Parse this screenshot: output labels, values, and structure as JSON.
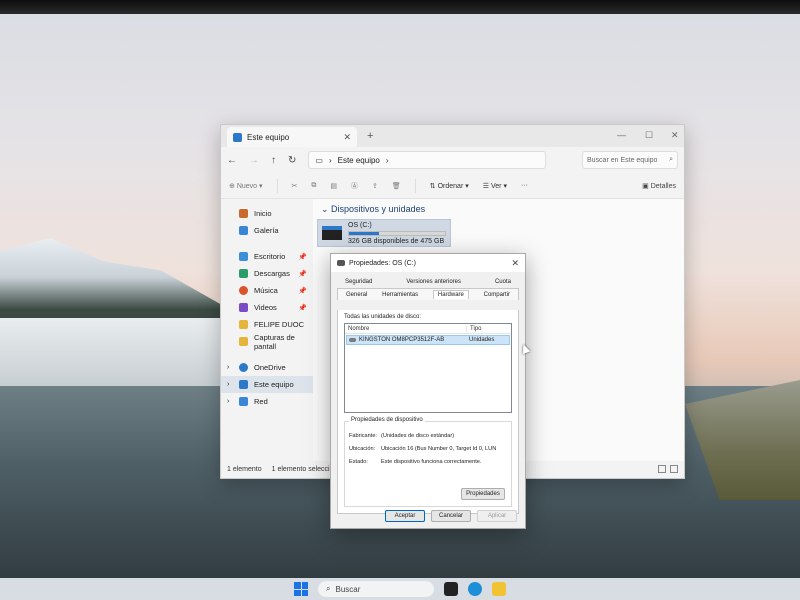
{
  "explorer": {
    "tab_title": "Este equipo",
    "tab_close": "✕",
    "new_tab": "+",
    "window_controls": [
      "—",
      "☐",
      "✕"
    ],
    "address": "Este equipo",
    "search_placeholder": "Buscar en Este equipo",
    "toolbar": {
      "new_label": "Nuevo",
      "sort_label": "Ordenar",
      "view_label": "Ver",
      "more_label": "···",
      "details_label": "Detalles"
    },
    "nav": {
      "items": [
        {
          "label": "Inicio"
        },
        {
          "label": "Galería"
        },
        {
          "label": "Escritorio"
        },
        {
          "label": "Descargas"
        },
        {
          "label": "Música"
        },
        {
          "label": "Videos"
        },
        {
          "label": "FELIPE DUOC"
        },
        {
          "label": "Capturas de pantall"
        },
        {
          "label": "OneDrive"
        },
        {
          "label": "Este equipo"
        },
        {
          "label": "Red"
        }
      ]
    },
    "section_title": "Dispositivos y unidades",
    "drive": {
      "name": "OS (C:)",
      "free_text": "326 GB disponibles de 475 GB",
      "used_fraction": 0.31
    },
    "status": {
      "count": "1 elemento",
      "selected": "1 elemento selecci"
    }
  },
  "dialog": {
    "title": "Propiedades: OS (C:)",
    "close": "✕",
    "tabs_back": [
      "Seguridad",
      "Versiones anteriores",
      "Cuota"
    ],
    "tabs_front": [
      "General",
      "Herramientas",
      "Hardware",
      "Compartir"
    ],
    "active_tab": "Hardware",
    "all_disks_label": "Todas las unidades de disco:",
    "columns": {
      "name": "Nombre",
      "type": "Tipo"
    },
    "disk": {
      "name": "KINGSTON OM8PCP3512F-AB",
      "type": "Unidades"
    },
    "properties_group": "Propiedades de dispositivo",
    "props": {
      "fabricante_k": "Fabricante:",
      "fabricante_v": "(Unidades de disco estándar)",
      "ubicacion_k": "Ubicación:",
      "ubicacion_v": "Ubicación 16 (Bus Number 0, Target Id 0, LUN",
      "estado_k": "Estado:",
      "estado_v": "Este dispositivo funciona correctamente."
    },
    "btn_properties": "Propiedades",
    "btn_ok": "Aceptar",
    "btn_cancel": "Cancelar",
    "btn_apply": "Aplicar"
  },
  "taskbar": {
    "search_label": "Buscar"
  }
}
